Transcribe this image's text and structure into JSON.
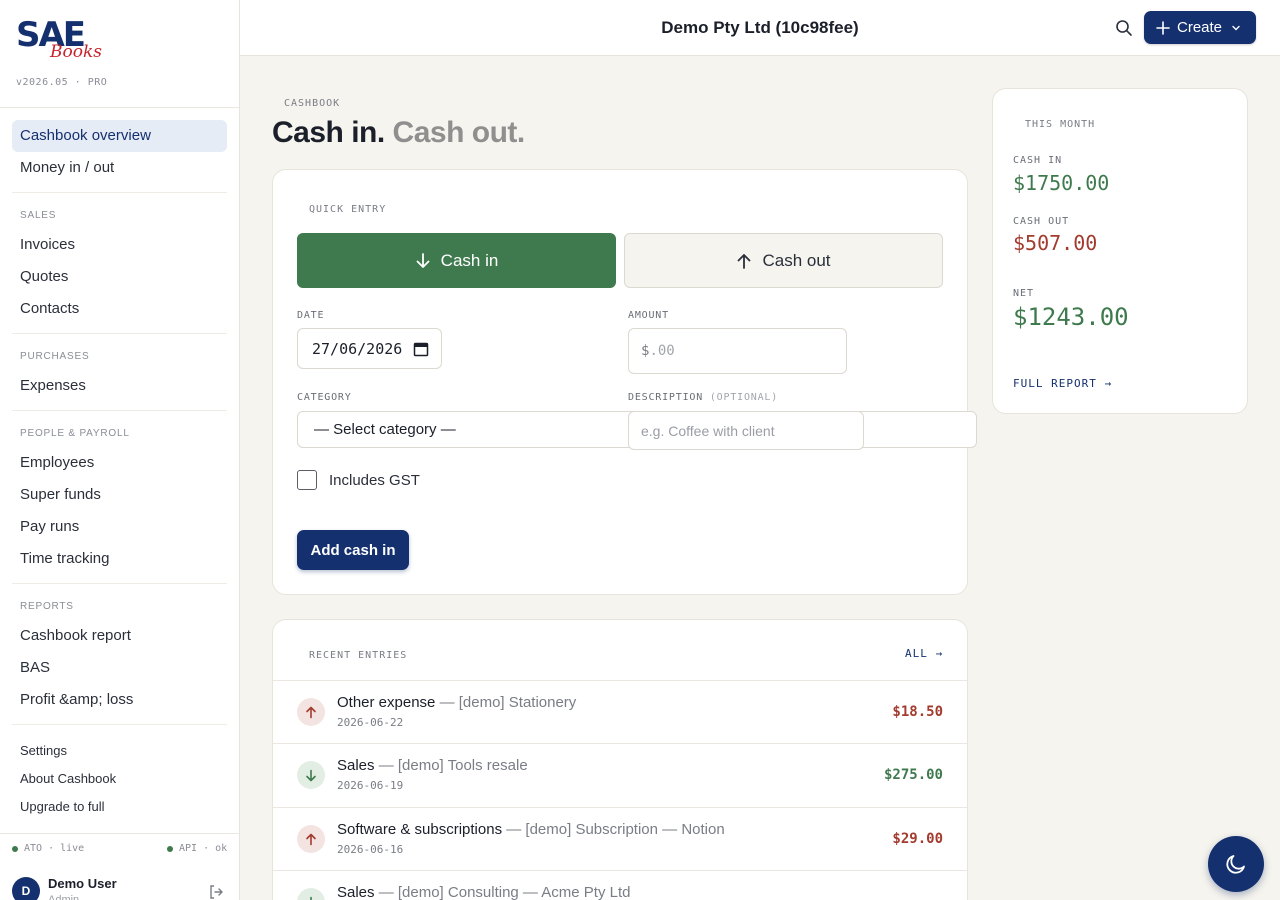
{
  "brand": {
    "logo_main": "SAE",
    "logo_sub": "Books",
    "version": "v2026.05 · PRO"
  },
  "sidebar": {
    "primary": [
      {
        "label": "Cashbook overview",
        "active": true
      },
      {
        "label": "Money in / out"
      }
    ],
    "sections": [
      {
        "title": "SALES",
        "items": [
          "Invoices",
          "Quotes",
          "Contacts"
        ]
      },
      {
        "title": "PURCHASES",
        "items": [
          "Expenses"
        ]
      },
      {
        "title": "PEOPLE & PAYROLL",
        "items": [
          "Employees",
          "Super funds",
          "Pay runs",
          "Time tracking"
        ]
      },
      {
        "title": "REPORTS",
        "items": [
          "Cashbook report",
          "BAS",
          "Profit &amp; loss"
        ]
      }
    ],
    "footer_links": [
      "Settings",
      "About Cashbook",
      "Upgrade to full"
    ],
    "status": {
      "ato": "ATO · live",
      "api": "API · ok"
    },
    "user": {
      "initial": "D",
      "name": "Demo User",
      "role": "Admin"
    }
  },
  "topbar": {
    "company": "Demo Pty Ltd (10c98fee)",
    "create_label": "Create"
  },
  "page": {
    "eyebrow": "CASHBOOK",
    "title_part1": "Cash in.",
    "title_part2": "Cash out."
  },
  "quick_entry": {
    "label": "QUICK ENTRY",
    "toggle_in": "Cash in",
    "toggle_out": "Cash out",
    "date_label": "DATE",
    "date_value": "27/06/2026",
    "amount_label": "AMOUNT",
    "amount_currency": "$",
    "amount_placeholder": ".00",
    "category_label": "CATEGORY",
    "category_value": "— Select category —",
    "description_label": "DESCRIPTION",
    "description_optional": "(OPTIONAL)",
    "description_placeholder": "e.g. Coffee with client",
    "gst_label": "Includes GST",
    "gst_checked": false,
    "submit_label": "Add cash in"
  },
  "recent": {
    "label": "RECENT ENTRIES",
    "all_link": "ALL →",
    "entries": [
      {
        "direction": "out",
        "category": "Other expense",
        "desc": " — [demo] Stationery",
        "date": "2026-06-22",
        "amount": "$18.50"
      },
      {
        "direction": "in",
        "category": "Sales",
        "desc": " — [demo] Tools resale",
        "date": "2026-06-19",
        "amount": "$275.00"
      },
      {
        "direction": "out",
        "category": "Software & subscriptions",
        "desc": " — [demo] Subscription — Notion",
        "date": "2026-06-16",
        "amount": "$29.00"
      },
      {
        "direction": "in",
        "category": "Sales",
        "desc": " — [demo] Consulting — Acme Pty Ltd",
        "date": "",
        "amount": ""
      }
    ]
  },
  "month": {
    "label": "THIS MONTH",
    "cash_in_label": "CASH IN",
    "cash_in": "$1750.00",
    "cash_out_label": "CASH OUT",
    "cash_out": "$507.00",
    "net_label": "NET",
    "net": "$1243.00",
    "report_link": "FULL REPORT →"
  },
  "colors": {
    "brand": "#14306e",
    "cash_in": "#3f7a4e",
    "cash_out": "#a33b2e",
    "logo_accent": "#c8232c"
  },
  "icons": [
    "search-icon",
    "plus-icon",
    "chevron-down-icon",
    "arrow-down-icon",
    "arrow-up-icon",
    "calendar-icon",
    "logout-icon",
    "moon-icon"
  ]
}
